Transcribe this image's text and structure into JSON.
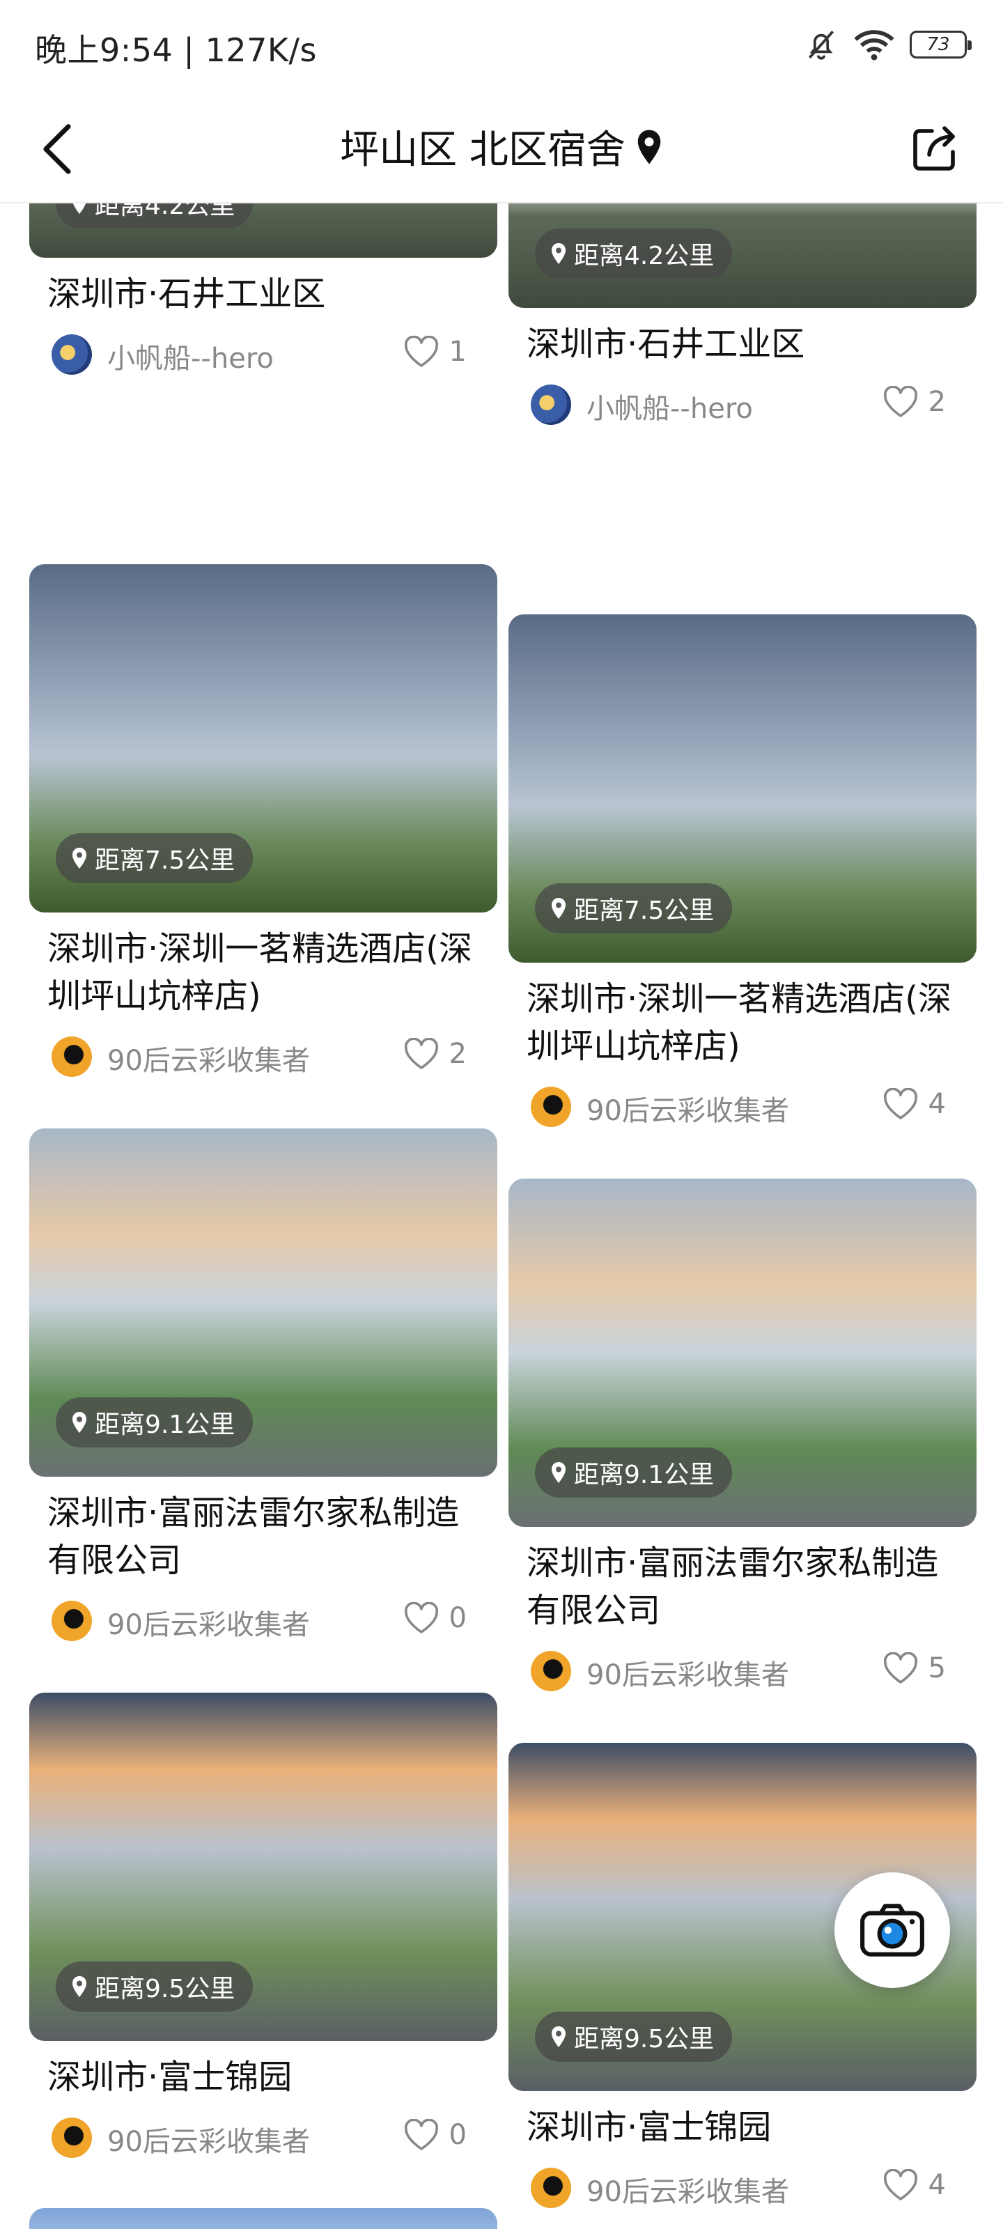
{
  "status_bar": {
    "time_speed": "晚上9:54 | 127K/s",
    "battery": "73"
  },
  "header": {
    "title": "坪山区 北区宿舍"
  },
  "cards_left": [
    {
      "distance": "距离4.2公里",
      "title": "深圳市·石井工业区",
      "author": "小帆船--hero",
      "likes": "1"
    },
    {
      "distance": "距离7.5公里",
      "title": "深圳市·深圳一茗精选酒店(深圳坪山坑梓店)",
      "author": "90后云彩收集者",
      "likes": "2"
    },
    {
      "distance": "距离9.1公里",
      "title": "深圳市·富丽法雷尔家私制造有限公司",
      "author": "90后云彩收集者",
      "likes": "0"
    },
    {
      "distance": "距离9.5公里",
      "title": "深圳市·富士锦园",
      "author": "90后云彩收集者",
      "likes": "0"
    }
  ],
  "cards_right": [
    {
      "distance": "距离4.2公里",
      "title": "深圳市·石井工业区",
      "author": "小帆船--hero",
      "likes": "2"
    },
    {
      "distance": "距离7.5公里",
      "title": "深圳市·深圳一茗精选酒店(深圳坪山坑梓店)",
      "author": "90后云彩收集者",
      "likes": "4"
    },
    {
      "distance": "距离9.1公里",
      "title": "深圳市·富丽法雷尔家私制造有限公司",
      "author": "90后云彩收集者",
      "likes": "5"
    },
    {
      "distance": "距离9.5公里",
      "title": "深圳市·富士锦园",
      "author": "90后云彩收集者",
      "likes": "4"
    }
  ],
  "icons": {
    "back": "chevron-left-icon",
    "location": "location-pin-icon",
    "share": "share-icon",
    "heart": "heart-outline-icon",
    "camera": "camera-icon"
  }
}
